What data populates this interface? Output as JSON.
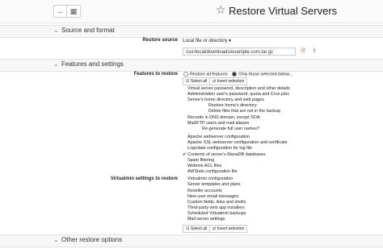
{
  "header": {
    "back_icon": "back-arrow-icon",
    "grid_icon": "grid-icon",
    "title": "Restore Virtual Servers",
    "star_icon": "star-icon"
  },
  "sections": {
    "source": {
      "label": "Source and format"
    },
    "features": {
      "label": "Features and settings"
    },
    "other": {
      "label": "Other restore options"
    }
  },
  "restore_source": {
    "label": "Restore source",
    "select_value": "Local file or directory",
    "path_value": "/usr/local/downloads/example.com.tar.gz"
  },
  "features_to_restore": {
    "label": "Features to restore",
    "radio_all": "Restore all features",
    "radio_selected": "Only those selected below...",
    "select_all": "Select all",
    "invert_selection": "Invert selection",
    "items": [
      "Virtual server password, description and other details",
      "Administration user's password, quota and Cron jobs",
      "Server's home directory and web pages",
      "Restore home's directory",
      "Delete files that are not in the backup",
      "Records in DNS domain, except SOA",
      "Mail/FTP users and mail aliases",
      "Re-generate full user names?",
      "Apache webserver configuration",
      "Apache SSL webserver configuration and certificate",
      "Logrotate configuration for log file",
      "Contents of server's MariaDB databases",
      "Spam filtering",
      "Webmin ACL files",
      "AWStats configuration file"
    ]
  },
  "virtualmin_settings": {
    "label": "Virtualmin settings to restore",
    "items": [
      "Virtualmin configuration",
      "Server templates and plans",
      "Reseller accounts",
      "New user email messages",
      "Custom fields, links and shells",
      "Third-party web app installers",
      "Scheduled Virtualmin backups",
      "Mail server settings"
    ],
    "select_all": "Select all",
    "invert_selection": "Invert selection"
  }
}
